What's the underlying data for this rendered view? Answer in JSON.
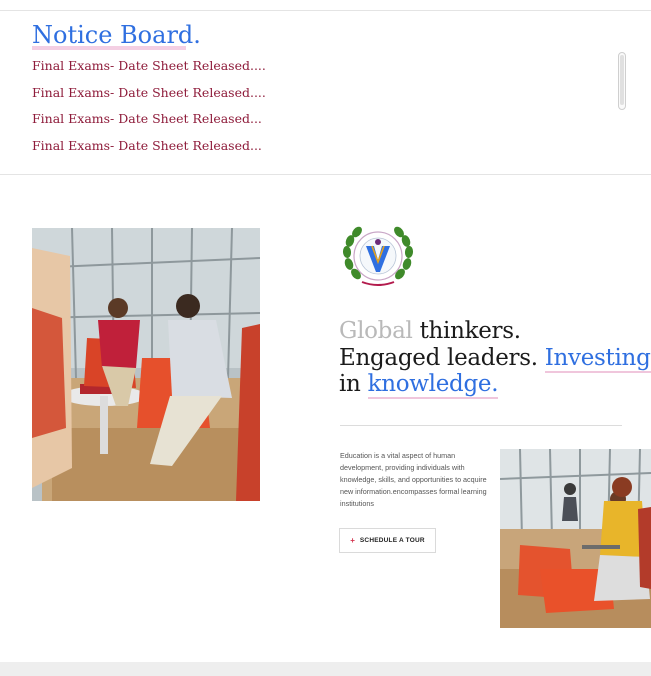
{
  "notice_board": {
    "title": "Notice Board.",
    "items": [
      {
        "label": "Final Exams- Date Sheet Released...."
      },
      {
        "label": "Final Exams- Date Sheet Released...."
      },
      {
        "label": "Final Exams- Date Sheet Released..."
      },
      {
        "label": "Final Exams- Date Sheet Released..."
      }
    ]
  },
  "hero": {
    "headline": {
      "part1_grey": "Global",
      "part2": " thinkers.",
      "part3": "Engaged leaders.",
      "part4_blue": "Investing",
      "part5": "in",
      "part6_blue": "knowledge."
    },
    "description": "Education is a vital aspect of human development, providing individuals with knowledge, skills, and opportunities to acquire new information.encompasses formal learning institutions",
    "button": {
      "label": "SCHEDULE A TOUR",
      "icon": "plus-icon"
    }
  },
  "colors": {
    "accent_blue": "#2f6fe0",
    "notice_red": "#8e1b3a",
    "highlight_pink": "#f0c6dc",
    "button_plus": "#d3344e"
  }
}
